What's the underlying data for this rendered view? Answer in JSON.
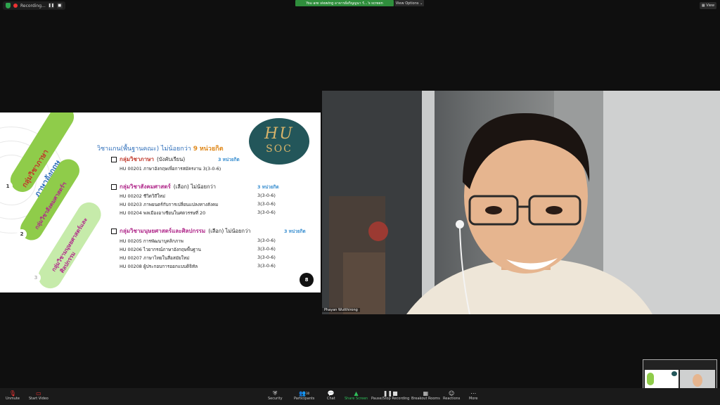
{
  "top": {
    "recording_label": "Recording...",
    "viewing_banner": "You are viewing อาจารย์อริญญนา รั...'s screen",
    "view_options": "View Options",
    "view_button": "View"
  },
  "slide": {
    "logo_line1": "HU",
    "logo_line2": "SOC",
    "pill1_text": "กลุ่มวิชาภาษา",
    "pill1_sub": "ภาษาอังกฤษ",
    "pill2_text": "กลุ่มวิชาสังคมศาสตร์ฯ",
    "pill3_text": "กลุ่มวิชามนุษยศาสตร์และ",
    "pill3_text2": "ศิลปกรรม",
    "num1": "1",
    "num2": "2",
    "num3": "3",
    "title_main": "วิชาแกน(พื้นฐานคณะ) ไม่น้อยกว่า",
    "title_num": "9",
    "title_unit": "หน่วยกิต",
    "sec1_title": "กลุ่มวิชาภาษา",
    "sec1_note": "(บังคับเรียน)",
    "sec1_credit": "3 หน่วยกิต",
    "sec1_rows": [
      "HU 00201 ภาษาอังกฤษเพื่อการสมัครงาน 3(3-0-6)"
    ],
    "sec2_title": "กลุ่มวิชาสังคมศาสตร์",
    "sec2_note": "(เลือก) ไม่น้อยกว่า",
    "sec2_credit": "3 หน่วยกิต",
    "sec2_rows": [
      {
        "code": "HU 00202 ชีวิตวิถีใหม่",
        "credit": "3(3-0-6)"
      },
      {
        "code": "HU 00203 ภาพยนตร์กับการเปลี่ยนแปลงทางสังคม",
        "credit": "3(3-0-6)"
      },
      {
        "code": "HU 00204 พลเมืองอาเซียนในศตวรรษที่ 20",
        "credit": "3(3-0-6)"
      }
    ],
    "sec3_title": "กลุ่มวิชามนุษยศาสตร์และศิลปกรรม",
    "sec3_note": "(เลือก) ไม่น้อยกว่า",
    "sec3_credit": "3 หน่วยกิต",
    "sec3_rows": [
      {
        "code": "HU 00205 การพัฒนาบุคลิกภาพ",
        "credit": "3(3-0-6)"
      },
      {
        "code": "HU 00206 ไวยากรณ์ภาษาอังกฤษพื้นฐาน",
        "credit": "3(3-0-6)"
      },
      {
        "code": "HU 00207 ภาษาไทยในสื่อสมัยใหม่",
        "credit": "3(3-0-6)"
      },
      {
        "code": "HU 00208 ผู้ประกอบการออกแบบดิจิทัล",
        "credit": "3(3-0-6)"
      }
    ],
    "page_number": "8"
  },
  "camera": {
    "participant_name": "Phayan Wutthirong"
  },
  "toolbar": {
    "unmute": "Unmute",
    "start_video": "Start Video",
    "security": "Security",
    "participants": "Participants",
    "participants_count": "30",
    "chat": "Chat",
    "share_screen": "Share Screen",
    "pause_recording": "Pause/Stop Recording",
    "breakout_rooms": "Breakout Rooms",
    "reactions": "Reactions",
    "more": "More"
  },
  "colors": {
    "pill_green": "#8fcc4a",
    "pill_light": "#c6ebaa",
    "title_blue": "#2f6fba",
    "red": "#c0392b",
    "magenta": "#b0288a",
    "accent_blue": "#3a8fd0",
    "orange": "#e08a1e"
  }
}
